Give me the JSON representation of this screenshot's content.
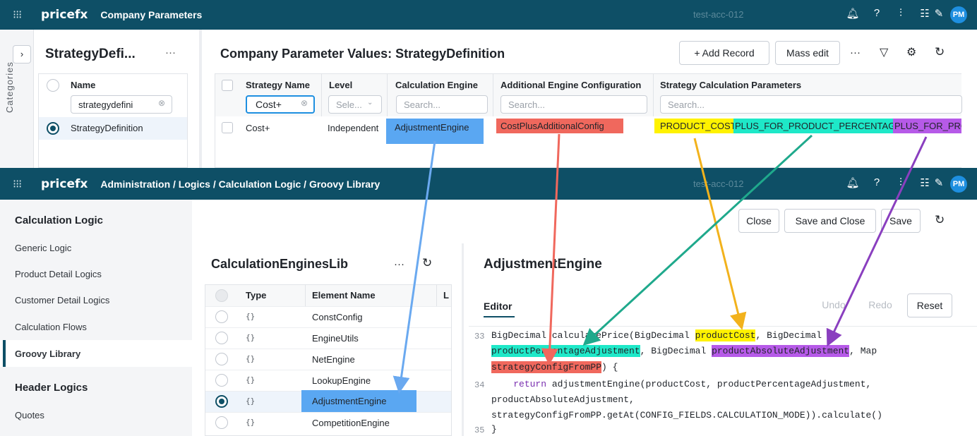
{
  "top": {
    "logo": "pricefx",
    "title": "Company Parameters",
    "account": "test-acc-012",
    "avatar": "PM",
    "strategy_panel": {
      "title": "StrategyDefi...",
      "more": "···",
      "categories_label": "Categories",
      "name_header": "Name",
      "name_filter": "strategydefini",
      "row": "StrategyDefinition"
    },
    "values_title": "Company Parameter Values: StrategyDefinition",
    "add_record": "+ Add Record",
    "mass_edit": "Mass edit",
    "more": "···",
    "columns": [
      "Strategy Name",
      "Level",
      "Calculation Engine",
      "Additional Engine Configuration",
      "Strategy Calculation Parameters"
    ],
    "filters": {
      "strategy_name": "Cost+",
      "level": "Sele...",
      "search": "Search..."
    },
    "row": {
      "strategy_name": "Cost+",
      "level": "Independent",
      "engine": "AdjustmentEngine",
      "config": "CostPlusAdditionalConfig",
      "params": [
        "PRODUCT_COST,",
        "PLUS_FOR_PRODUCT_PERCENTAGE,",
        "PLUS_FOR_PRO"
      ]
    }
  },
  "bottom": {
    "logo": "pricefx",
    "breadcrumb": "Administration  /  Logics  /  Calculation Logic  /  Groovy Library",
    "account": "test-acc-012",
    "avatar": "PM",
    "nav": {
      "heading1": "Calculation Logic",
      "items": [
        "Generic Logic",
        "Product Detail Logics",
        "Customer Detail Logics",
        "Calculation Flows",
        "Groovy Library"
      ],
      "heading2": "Header Logics",
      "items2": [
        "Quotes"
      ]
    },
    "actions": {
      "close": "Close",
      "save_close": "Save and Close",
      "save": "Save"
    },
    "lib": {
      "title": "CalculationEnginesLib",
      "more": "···",
      "headers": [
        "Type",
        "Element Name",
        "L"
      ],
      "rows": [
        {
          "type": "{}",
          "name": "ConstConfig"
        },
        {
          "type": "{}",
          "name": "EngineUtils"
        },
        {
          "type": "{}",
          "name": "NetEngine"
        },
        {
          "type": "{}",
          "name": "LookupEngine"
        },
        {
          "type": "{}",
          "name": "AdjustmentEngine"
        },
        {
          "type": "{}",
          "name": "CompetitionEngine"
        }
      ]
    },
    "editor": {
      "title": "AdjustmentEngine",
      "tab": "Editor",
      "undo": "Undo",
      "redo": "Redo",
      "reset": "Reset",
      "lines": {
        "n33": "33",
        "n34": "34",
        "n35": "35",
        "l1a": "BigDecimal calculatePrice(BigDecimal ",
        "l1b": "productCost",
        "l1c": ", BigDecimal",
        "l2a": "productPercentageAdjustment",
        "l2b": ", BigDecimal ",
        "l2c": "productAbsoluteAdjustment",
        "l2d": ", Map",
        "l3a": "strategyConfigFromPP",
        "l3b": ") {",
        "l4kw": "return",
        "l4": " adjustmentEngine(productCost, productPercentageAdjustment,",
        "l5": "productAbsoluteAdjustment,",
        "l6": "strategyConfigFromPP.getAt(CONFIG_FIELDS.CALCULATION_MODE)).calculate()",
        "l7": "}"
      }
    }
  },
  "colors": {
    "topbar": "#0e4f66",
    "blue": "#5aa7f2",
    "red": "#f0685d",
    "yellow": "#fff200",
    "teal": "#1ee8c8",
    "purple": "#b65ae8",
    "arrow_yellow": "#f2b21c",
    "arrow_teal": "#1fa98c",
    "arrow_purple": "#8a3fbf"
  }
}
